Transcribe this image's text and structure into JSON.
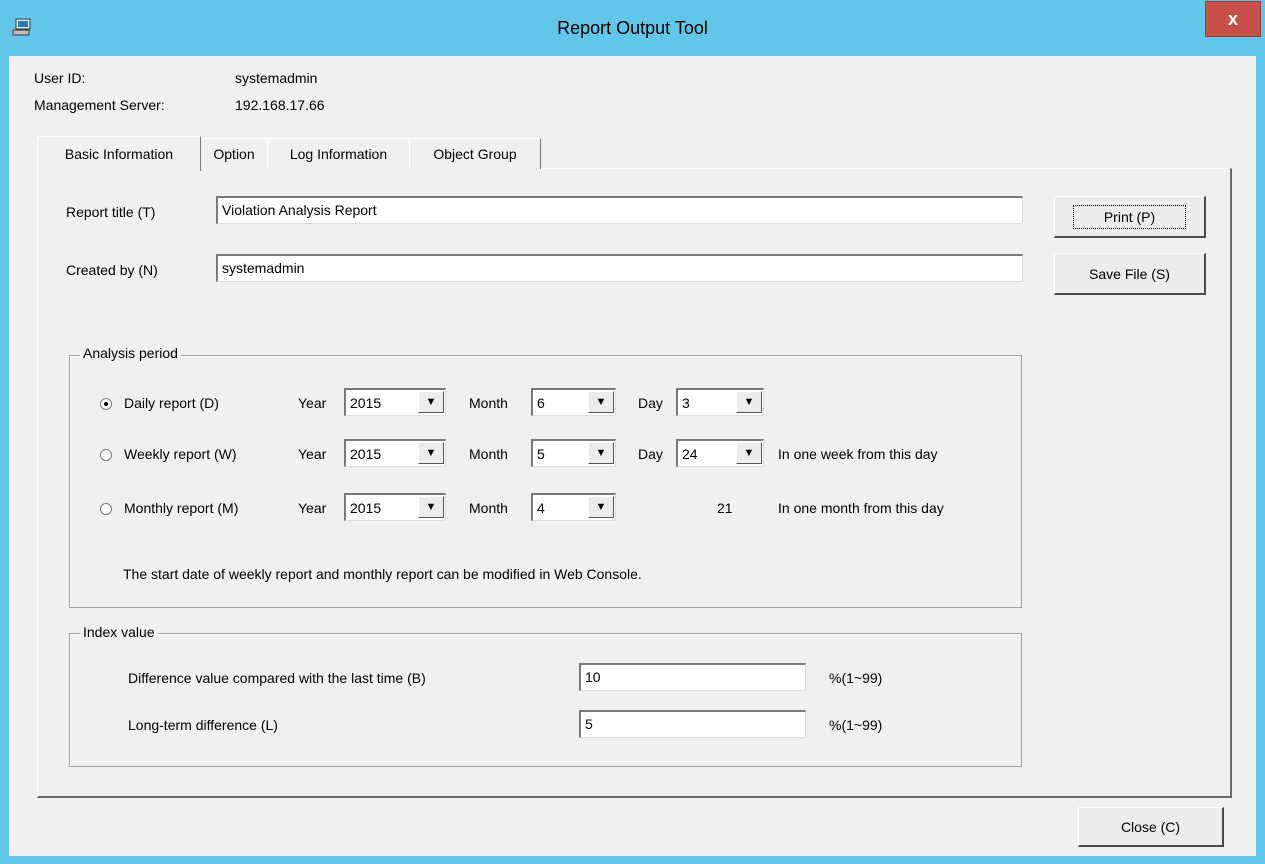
{
  "window": {
    "title": "Report Output Tool",
    "close_glyph": "x",
    "icon": "app-monitor-icon"
  },
  "info": {
    "user_id_label": "User ID:",
    "user_id_value": "systemadmin",
    "server_label": "Management Server:",
    "server_value": "192.168.17.66"
  },
  "tabs": [
    {
      "label": "Basic Information",
      "active": true
    },
    {
      "label": "Option",
      "active": false
    },
    {
      "label": "Log Information",
      "active": false
    },
    {
      "label": "Object Group",
      "active": false
    }
  ],
  "form": {
    "report_title_label": "Report title (T)",
    "report_title_value": "Violation Analysis Report",
    "created_by_label": "Created by (N)",
    "created_by_value": "systemadmin"
  },
  "buttons": {
    "print": "Print (P)",
    "save_file": "Save File (S)",
    "close": "Close (C)"
  },
  "analysis": {
    "title": "Analysis period",
    "year_label": "Year",
    "month_label": "Month",
    "day_label": "Day",
    "daily": {
      "label": "Daily report (D)",
      "selected": true,
      "year": "2015",
      "month": "6",
      "day": "3"
    },
    "weekly": {
      "label": "Weekly report (W)",
      "selected": false,
      "year": "2015",
      "month": "5",
      "day": "24",
      "note": "In one week from this day"
    },
    "monthly": {
      "label": "Monthly report (M)",
      "selected": false,
      "year": "2015",
      "month": "4",
      "day_text": "21",
      "note": "In one month from this day"
    },
    "footnote": "The start date of weekly report and monthly report can be modified in Web Console."
  },
  "index": {
    "title": "Index value",
    "diff_label": "Difference value compared with the last time (B)",
    "diff_value": "10",
    "diff_range": "%(1~99)",
    "long_label": "Long-term difference (L)",
    "long_value": "5",
    "long_range": "%(1~99)"
  },
  "colors": {
    "titlebar": "#62c6e8",
    "close_button": "#c7504a",
    "dialog": "#f0f0f0"
  }
}
